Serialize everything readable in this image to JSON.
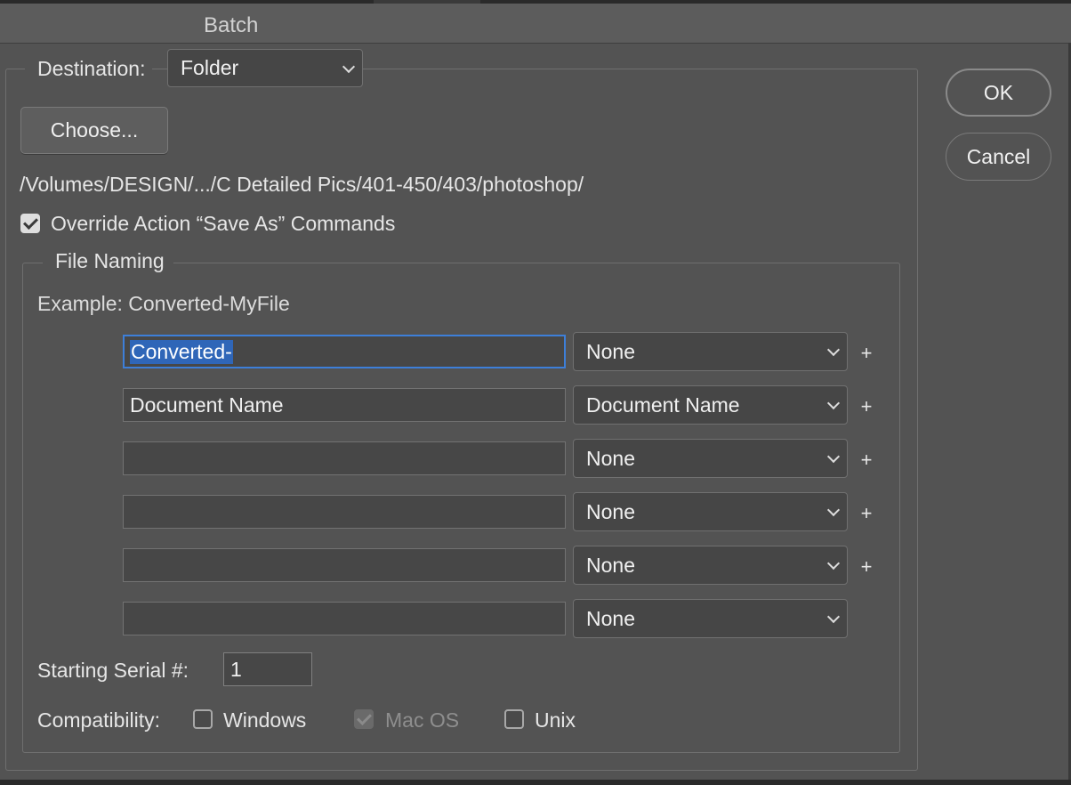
{
  "window": {
    "title": "Batch"
  },
  "destination": {
    "label": "Destination:",
    "selected": "Folder",
    "choose_label": "Choose...",
    "path": "/Volumes/DESIGN/.../C Detailed Pics/401-450/403/photoshop/",
    "override_label": "Override Action “Save As” Commands",
    "override_checked": true
  },
  "buttons": {
    "ok": "OK",
    "cancel": "Cancel"
  },
  "file_naming": {
    "legend": "File Naming",
    "example": "Example: Converted-MyFile",
    "rows": [
      {
        "text": "Converted-",
        "select": "None",
        "plus": "+"
      },
      {
        "text": "Document Name",
        "select": "Document Name",
        "plus": "+"
      },
      {
        "text": "",
        "select": "None",
        "plus": "+"
      },
      {
        "text": "",
        "select": "None",
        "plus": "+"
      },
      {
        "text": "",
        "select": "None",
        "plus": "+"
      },
      {
        "text": "",
        "select": "None",
        "plus": ""
      }
    ],
    "serial_label": "Starting Serial #:",
    "serial_value": "1",
    "compat_label": "Compatibility:",
    "compat": {
      "windows": {
        "label": "Windows",
        "checked": false
      },
      "macos": {
        "label": "Mac OS",
        "checked": true,
        "disabled": true
      },
      "unix": {
        "label": "Unix",
        "checked": false
      }
    }
  }
}
